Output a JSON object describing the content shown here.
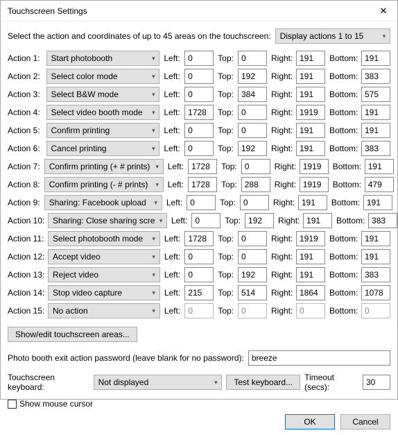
{
  "title": "Touchscreen Settings",
  "intro": "Select the action and coordinates of up to 45 areas on the touchscreen:",
  "display_selector": "Display actions 1 to 15",
  "coord_labels": {
    "left": "Left:",
    "top": "Top:",
    "right": "Right:",
    "bottom": "Bottom:"
  },
  "actions": [
    {
      "idx": 1,
      "label": "Action 1:",
      "value": "Start photobooth",
      "left": "0",
      "top": "0",
      "right": "191",
      "bottom": "191",
      "disabled": false
    },
    {
      "idx": 2,
      "label": "Action 2:",
      "value": "Select color mode",
      "left": "0",
      "top": "192",
      "right": "191",
      "bottom": "383",
      "disabled": false
    },
    {
      "idx": 3,
      "label": "Action 3:",
      "value": "Select B&W mode",
      "left": "0",
      "top": "384",
      "right": "191",
      "bottom": "575",
      "disabled": false
    },
    {
      "idx": 4,
      "label": "Action 4:",
      "value": "Select video booth mode",
      "left": "1728",
      "top": "0",
      "right": "1919",
      "bottom": "191",
      "disabled": false
    },
    {
      "idx": 5,
      "label": "Action 5:",
      "value": "Confirm printing",
      "left": "0",
      "top": "0",
      "right": "191",
      "bottom": "191",
      "disabled": false
    },
    {
      "idx": 6,
      "label": "Action 6:",
      "value": "Cancel printing",
      "left": "0",
      "top": "192",
      "right": "191",
      "bottom": "383",
      "disabled": false
    },
    {
      "idx": 7,
      "label": "Action 7:",
      "value": "Confirm printing (+ # prints)",
      "left": "1728",
      "top": "0",
      "right": "1919",
      "bottom": "191",
      "disabled": false
    },
    {
      "idx": 8,
      "label": "Action 8:",
      "value": "Confirm printing (- # prints)",
      "left": "1728",
      "top": "288",
      "right": "1919",
      "bottom": "479",
      "disabled": false
    },
    {
      "idx": 9,
      "label": "Action 9:",
      "value": "Sharing: Facebook upload",
      "left": "0",
      "top": "0",
      "right": "191",
      "bottom": "191",
      "disabled": false
    },
    {
      "idx": 10,
      "label": "Action 10:",
      "value": "Sharing: Close sharing screen",
      "left": "0",
      "top": "192",
      "right": "191",
      "bottom": "383",
      "disabled": false
    },
    {
      "idx": 11,
      "label": "Action 11:",
      "value": "Select photobooth mode",
      "left": "1728",
      "top": "0",
      "right": "1919",
      "bottom": "191",
      "disabled": false
    },
    {
      "idx": 12,
      "label": "Action 12:",
      "value": "Accept video",
      "left": "0",
      "top": "0",
      "right": "191",
      "bottom": "191",
      "disabled": false
    },
    {
      "idx": 13,
      "label": "Action 13:",
      "value": "Reject video",
      "left": "0",
      "top": "192",
      "right": "191",
      "bottom": "383",
      "disabled": false
    },
    {
      "idx": 14,
      "label": "Action 14:",
      "value": "Stop video capture",
      "left": "215",
      "top": "514",
      "right": "1864",
      "bottom": "1078",
      "disabled": false
    },
    {
      "idx": 15,
      "label": "Action 15:",
      "value": "No action",
      "left": "0",
      "top": "0",
      "right": "0",
      "bottom": "0",
      "disabled": true
    }
  ],
  "show_edit_button": "Show/edit touchscreen areas...",
  "password": {
    "label": "Photo booth exit action password (leave blank for no password):",
    "value": "breeze"
  },
  "keyboard": {
    "label": "Touchscreen keyboard:",
    "value": "Not displayed",
    "test_button": "Test keyboard...",
    "timeout_label": "Timeout (secs):",
    "timeout_value": "30"
  },
  "show_mouse": {
    "label": "Show mouse cursor",
    "checked": false
  },
  "buttons": {
    "ok": "OK",
    "cancel": "Cancel"
  }
}
